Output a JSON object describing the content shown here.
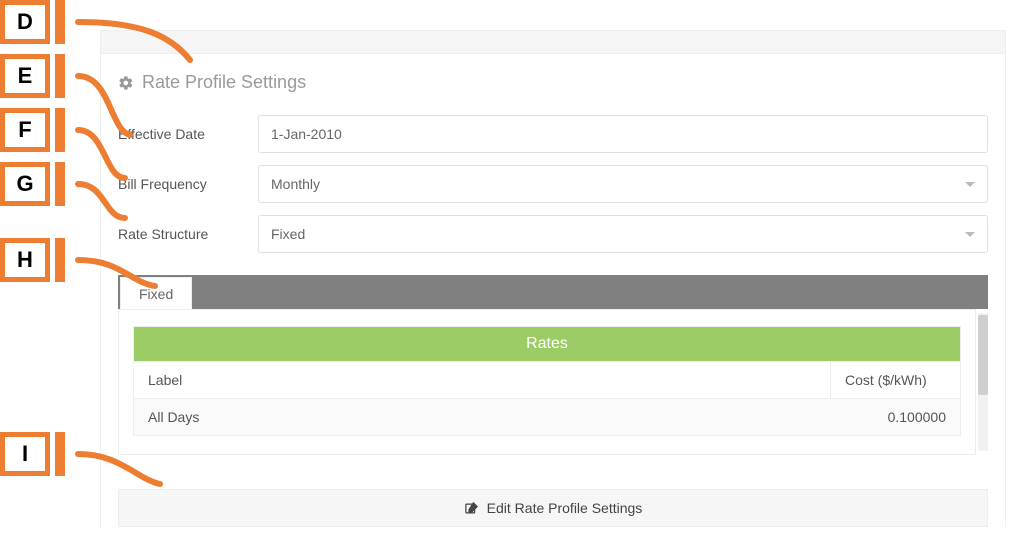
{
  "callouts": {
    "d": "D",
    "e": "E",
    "f": "F",
    "g": "G",
    "h": "H",
    "i": "I"
  },
  "section": {
    "title": "Rate Profile Settings"
  },
  "form": {
    "effective_date": {
      "label": "Effective Date",
      "value": "1-Jan-2010"
    },
    "bill_frequency": {
      "label": "Bill Frequency",
      "value": "Monthly"
    },
    "rate_structure": {
      "label": "Rate Structure",
      "value": "Fixed"
    }
  },
  "tabs": {
    "fixed": {
      "label": "Fixed"
    }
  },
  "rates": {
    "title": "Rates",
    "header": {
      "label": "Label",
      "cost": "Cost ($/kWh)"
    },
    "rows": [
      {
        "label": "All Days",
        "cost": "0.100000"
      }
    ]
  },
  "edit": {
    "label": "Edit Rate Profile Settings"
  }
}
